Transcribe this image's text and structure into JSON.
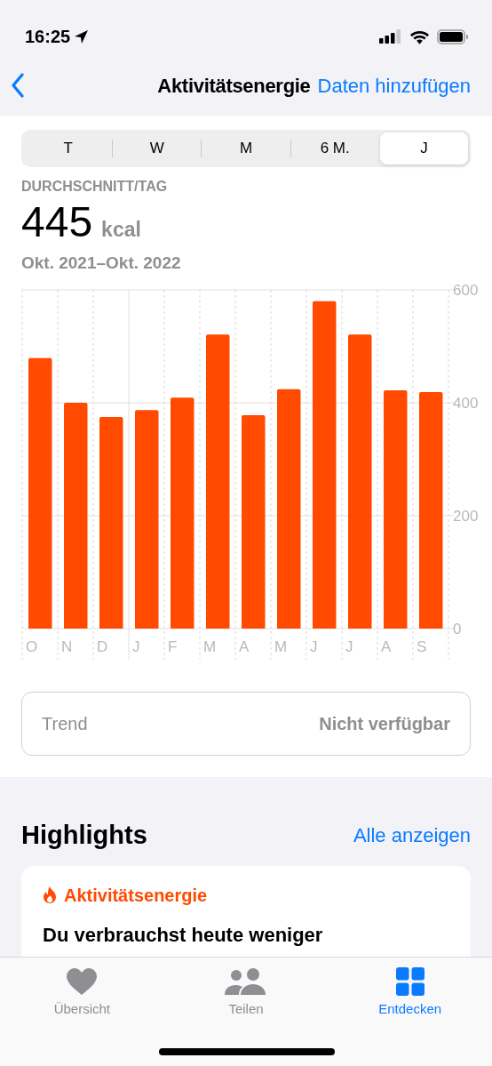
{
  "status_bar": {
    "time": "16:25"
  },
  "nav": {
    "title": "Aktivitätsenergie",
    "action": "Daten hinzufügen"
  },
  "periods": [
    {
      "label": "T",
      "selected": false
    },
    {
      "label": "W",
      "selected": false
    },
    {
      "label": "M",
      "selected": false
    },
    {
      "label": "6 M.",
      "selected": false
    },
    {
      "label": "J",
      "selected": true
    }
  ],
  "summary": {
    "label": "DURCHSCHNITT/TAG",
    "value": "445",
    "unit": "kcal",
    "range": "Okt. 2021–Okt. 2022"
  },
  "chart_data": {
    "type": "bar",
    "categories": [
      "O",
      "N",
      "D",
      "J",
      "F",
      "M",
      "A",
      "M",
      "J",
      "J",
      "A",
      "S"
    ],
    "series": [
      {
        "color": "#ff4a00",
        "values": [
          479,
          400,
          375,
          387,
          409,
          521,
          378,
          424,
          580,
          521,
          422,
          419
        ]
      }
    ],
    "ylim": [
      0,
      600
    ],
    "yticks": [
      0,
      200,
      400,
      600
    ]
  },
  "trend": {
    "label": "Trend",
    "value": "Nicht verfügbar"
  },
  "highlights": {
    "title": "Highlights",
    "action": "Alle anzeigen",
    "card": {
      "category": "Aktivitätsenergie",
      "text": "Du verbrauchst heute weniger"
    }
  },
  "tab_bar": [
    {
      "label": "Übersicht",
      "kind": "heart",
      "selected": false
    },
    {
      "label": "Teilen",
      "kind": "people",
      "selected": false
    },
    {
      "label": "Entdecken",
      "kind": "grid",
      "selected": true
    }
  ]
}
